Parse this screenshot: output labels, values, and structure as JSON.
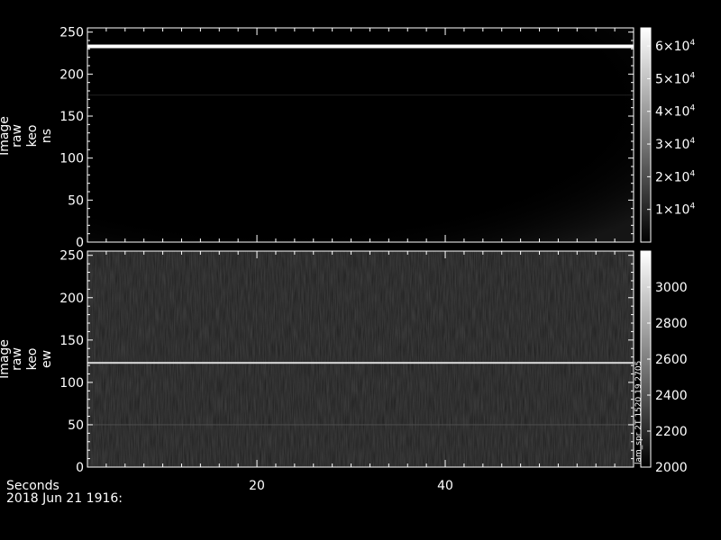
{
  "chart_data": [
    {
      "type": "heatmap",
      "panel": "top",
      "ylabel_lines": [
        "Image",
        "raw",
        "keo",
        "ns"
      ],
      "ylim": [
        0,
        255
      ],
      "yticks": [
        0,
        50,
        100,
        150,
        200,
        250
      ],
      "xlim": [
        2,
        60
      ],
      "colorbar": {
        "range": [
          0,
          65535
        ],
        "ticks": [
          {
            "value": 10000,
            "mantissa": "1",
            "base": "×10",
            "exp": "4"
          },
          {
            "value": 20000,
            "mantissa": "2",
            "base": "×10",
            "exp": "4"
          },
          {
            "value": 30000,
            "mantissa": "3",
            "base": "×10",
            "exp": "4"
          },
          {
            "value": 40000,
            "mantissa": "4",
            "base": "×10",
            "exp": "4"
          },
          {
            "value": 50000,
            "mantissa": "5",
            "base": "×10",
            "exp": "4"
          },
          {
            "value": 60000,
            "mantissa": "6",
            "base": "×10",
            "exp": "4"
          }
        ]
      },
      "features": [
        {
          "kind": "bright-band",
          "y": 233,
          "brightness": 1.0
        },
        {
          "kind": "dim-band",
          "y": 175,
          "brightness": 0.12
        }
      ]
    },
    {
      "type": "heatmap",
      "panel": "bottom",
      "ylabel_lines": [
        "Image",
        "raw",
        "keo",
        "ew"
      ],
      "ylim": [
        0,
        255
      ],
      "yticks": [
        0,
        50,
        100,
        150,
        200,
        250
      ],
      "xlim": [
        2,
        60
      ],
      "colorbar": {
        "range": [
          2000,
          3200
        ],
        "ticks": [
          2000,
          2200,
          2400,
          2600,
          2800,
          3000
        ]
      },
      "features": [
        {
          "kind": "bright-band",
          "y": 122,
          "brightness": 0.85
        },
        {
          "kind": "dim-band",
          "y": 50,
          "brightness": 0.3
        }
      ],
      "side_note": "lam_spr 2T 1520 19 2705"
    }
  ],
  "xaxis": {
    "label": "Seconds",
    "ticks": [
      20,
      40
    ],
    "date_label": "2018 Jun 21 1916:"
  }
}
